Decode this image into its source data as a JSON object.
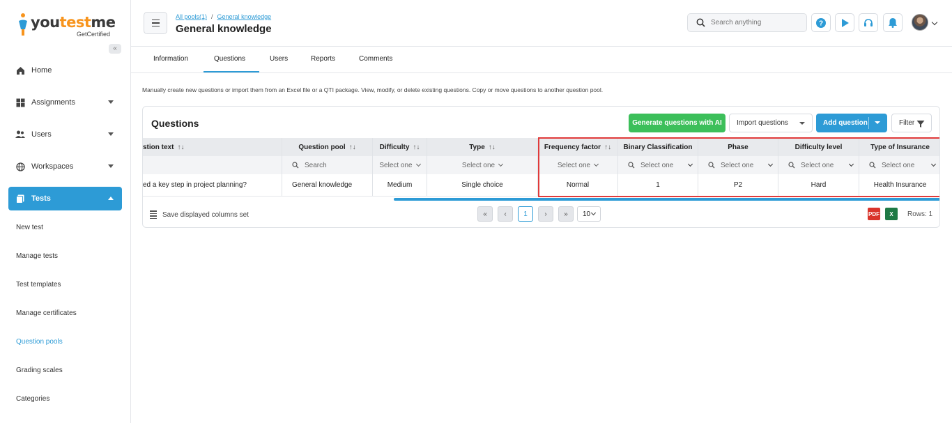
{
  "brand": {
    "name_part1": "you",
    "name_part2": "test",
    "name_part3": "me",
    "tagline": "GetCertified"
  },
  "sidebar": {
    "items": [
      {
        "label": "Home",
        "icon": "home-icon"
      },
      {
        "label": "Assignments",
        "icon": "assignments-icon"
      },
      {
        "label": "Users",
        "icon": "users-icon"
      },
      {
        "label": "Workspaces",
        "icon": "globe-icon"
      },
      {
        "label": "Tests",
        "icon": "tests-icon"
      }
    ],
    "sub_items": [
      {
        "label": "New test"
      },
      {
        "label": "Manage tests"
      },
      {
        "label": "Test templates"
      },
      {
        "label": "Manage certificates"
      },
      {
        "label": "Question pools"
      },
      {
        "label": "Grading scales"
      },
      {
        "label": "Categories"
      }
    ]
  },
  "header": {
    "breadcrumb": [
      "All pools(1)",
      "General knowledge"
    ],
    "breadcrumb_sep": "/",
    "title": "General knowledge",
    "search_placeholder": "Search anything"
  },
  "tabs": [
    "Information",
    "Questions",
    "Users",
    "Reports",
    "Comments"
  ],
  "description": "Manually create new questions or import them from an Excel file or a QTI package. View, modify, or delete existing questions. Copy or move questions to another question pool.",
  "card": {
    "title": "Questions",
    "generate_label": "Generate questions with AI",
    "import_label": "Import questions",
    "add_label": "Add question",
    "filter_label": "Filter"
  },
  "table": {
    "columns": [
      "stion text",
      "Question pool",
      "Difficulty",
      "Type",
      "Frequency factor",
      "Binary Classification",
      "Phase",
      "Difficulty level",
      "Type of Insurance"
    ],
    "sort_glyph": "↑↓",
    "filters": {
      "search_placeholder": "Search",
      "select_one": "Select one"
    },
    "row": [
      "ed a key step in project planning?",
      "General knowledge",
      "Medium",
      "Single choice",
      "Normal",
      "1",
      "P2",
      "Hard",
      "Health Insurance"
    ]
  },
  "footer": {
    "save_columns": "Save displayed columns set",
    "current_page": "1",
    "page_size": "10",
    "rows": "Rows: 1",
    "pdf_label": "PDF",
    "excel_label": "X"
  },
  "colors": {
    "primary": "#2d9bd6",
    "green": "#3cbf5a",
    "highlight": "#e03a3a"
  }
}
